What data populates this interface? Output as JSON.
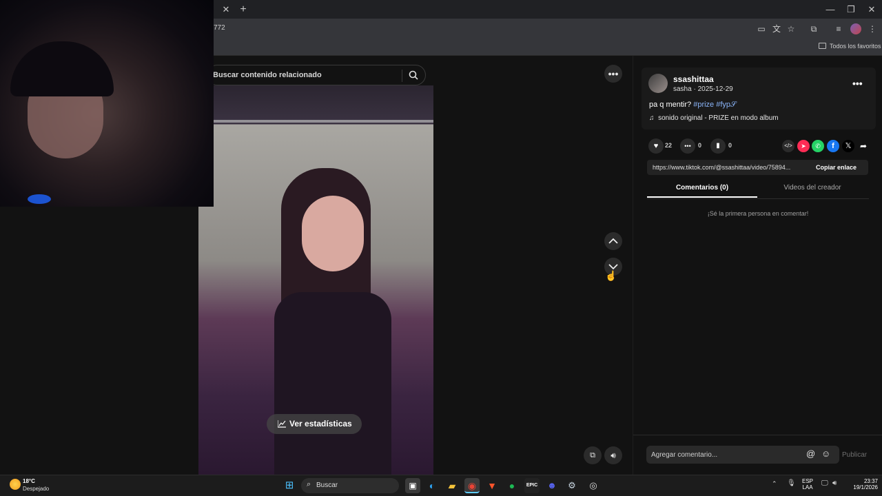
{
  "browser": {
    "url_fragment": "772",
    "bookmarks_label": "Todos los favoritos",
    "window_controls": {
      "minimize": "—",
      "maximize": "❐",
      "close": "✕"
    },
    "new_tab": "+",
    "tab_close": "✕"
  },
  "search": {
    "placeholder": "Buscar contenido relacionado"
  },
  "video": {
    "stats_button": "Ver estadísticas"
  },
  "post": {
    "username": "ssashittaa",
    "display_and_date": "sasha · 2025-12-29",
    "caption_text": "pa q mentir?",
    "hashtags": "#prize #fyp𝒮",
    "music": "sonido original - PRIZE en modo album",
    "likes": "22",
    "comments": "0",
    "saves": "0",
    "link": "https://www.tiktok.com/@ssashittaa/video/75894...",
    "copy_link": "Copiar enlace",
    "tabs": [
      "Comentarios (0)",
      "Videos del creador"
    ],
    "empty_comments": "¡Sé la primera persona en comentar!",
    "comment_placeholder": "Agregar comentario...",
    "publish": "Publicar"
  },
  "taskbar": {
    "weather_temp": "18°C",
    "weather_desc": "Despejado",
    "search_label": "Buscar",
    "lang_top": "ESP",
    "lang_bottom": "LAA",
    "time": "23:37",
    "date": "19/1/2026"
  },
  "colors": {
    "hashtag": "#8ab4f8",
    "accent": "#fe2c55"
  }
}
